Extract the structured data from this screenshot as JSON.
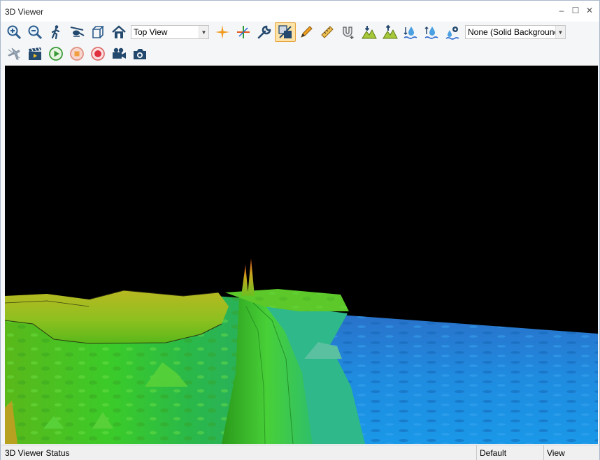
{
  "window": {
    "title": "3D Viewer"
  },
  "titlebar_buttons": {
    "minimize": "–",
    "maximize": "☐",
    "close": "✕"
  },
  "toolbar1": {
    "view_combo": {
      "value": "Top View"
    },
    "background_combo": {
      "value": "None (Solid Background"
    },
    "active_tool": "layer-draping"
  },
  "toolbar2": {},
  "status": {
    "main": "3D Viewer Status",
    "default": "Default",
    "mode": "View"
  },
  "colors": {
    "terrain_low": "#1e8fd8",
    "terrain_mid": "#2ecc2e",
    "terrain_high": "#c9b21e",
    "terrain_peak": "#d24a1a",
    "background": "#000000"
  }
}
